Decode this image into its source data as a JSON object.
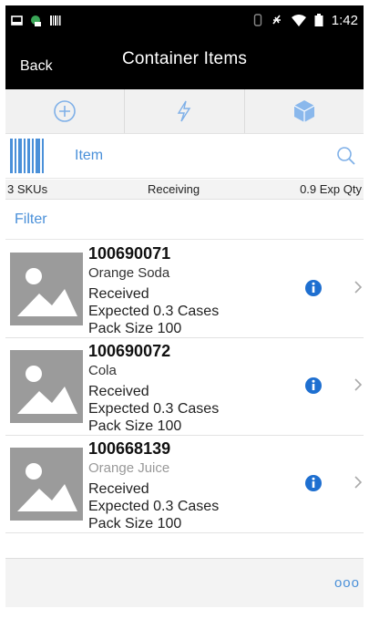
{
  "status_bar": {
    "time": "1:42",
    "icons": [
      "screenshot-icon",
      "app-icon",
      "barcode-icon",
      "vibrate-icon",
      "mute-icon",
      "wifi-icon",
      "battery-icon"
    ]
  },
  "header": {
    "back_label": "Back",
    "title": "Container Items"
  },
  "toolbar": {
    "buttons": [
      "add-icon",
      "lightning-icon",
      "container-icon"
    ]
  },
  "scan": {
    "item_label": "Item"
  },
  "summary": {
    "skus": "3 SKUs",
    "status": "Receiving",
    "exp_qty": "0.9 Exp Qty"
  },
  "filter": {
    "label": "Filter"
  },
  "items": [
    {
      "sku": "100690071",
      "description": "Orange Soda",
      "status": "Received",
      "expected": "Expected  0.3  Cases",
      "pack_size": "Pack Size 100"
    },
    {
      "sku": "100690072",
      "description": "Cola",
      "status": "Received",
      "expected": "Expected  0.3  Cases",
      "pack_size": "Pack Size 100"
    },
    {
      "sku": "100668139",
      "description": "Orange Juice",
      "status": "Received",
      "expected": "Expected  0.3  Cases",
      "pack_size": "Pack Size 100"
    }
  ],
  "footer": {
    "more_label": "ooo"
  },
  "colors": {
    "accent": "#4a90d9",
    "info": "#1e6fd0",
    "toolbar_bg": "#f1f1f1",
    "header_bg": "#000000"
  }
}
